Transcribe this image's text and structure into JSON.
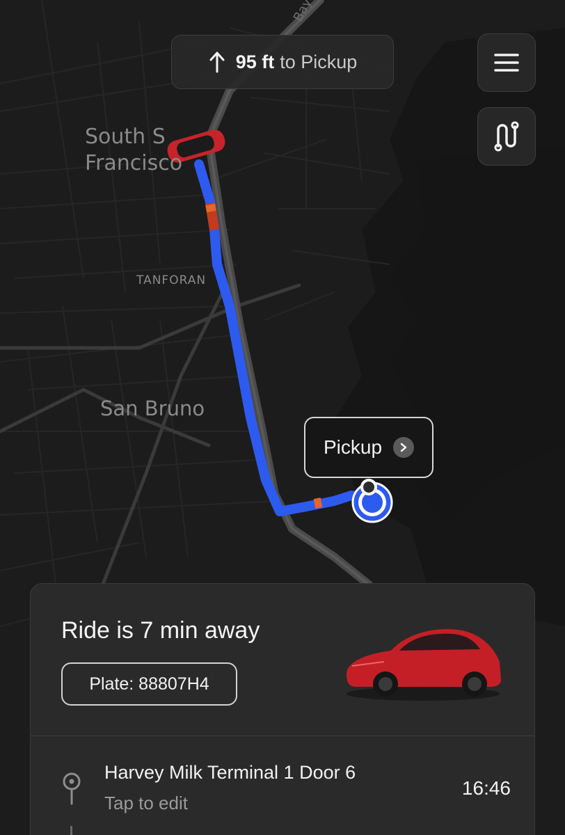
{
  "map": {
    "labels": {
      "south_sf": "South S\nFrancisco",
      "tanforan": "TANFORAN",
      "san_bruno": "San Bruno",
      "bay": "Bay"
    },
    "colors": {
      "route": "#2d5bf0",
      "traffic_heavy": "#c43a1c",
      "traffic_medium": "#e3662a",
      "vehicle": "#c7232a"
    }
  },
  "navigation": {
    "direction_icon": "arrow-up-icon",
    "distance": "95 ft",
    "destination": "to Pickup"
  },
  "controls": {
    "menu_icon": "hamburger-menu-icon",
    "route_icon": "route-icon"
  },
  "pickup_callout": {
    "label": "Pickup",
    "icon": "chevron-right-icon"
  },
  "ride": {
    "status": "Ride is 7 min away",
    "plate": "Plate: 88807H4",
    "vehicle_color": "#c41f26"
  },
  "destination": {
    "icon": "location-pin-icon",
    "name": "Harvey Milk Terminal 1 Door 6",
    "action": "Tap to edit",
    "eta": "16:46"
  }
}
